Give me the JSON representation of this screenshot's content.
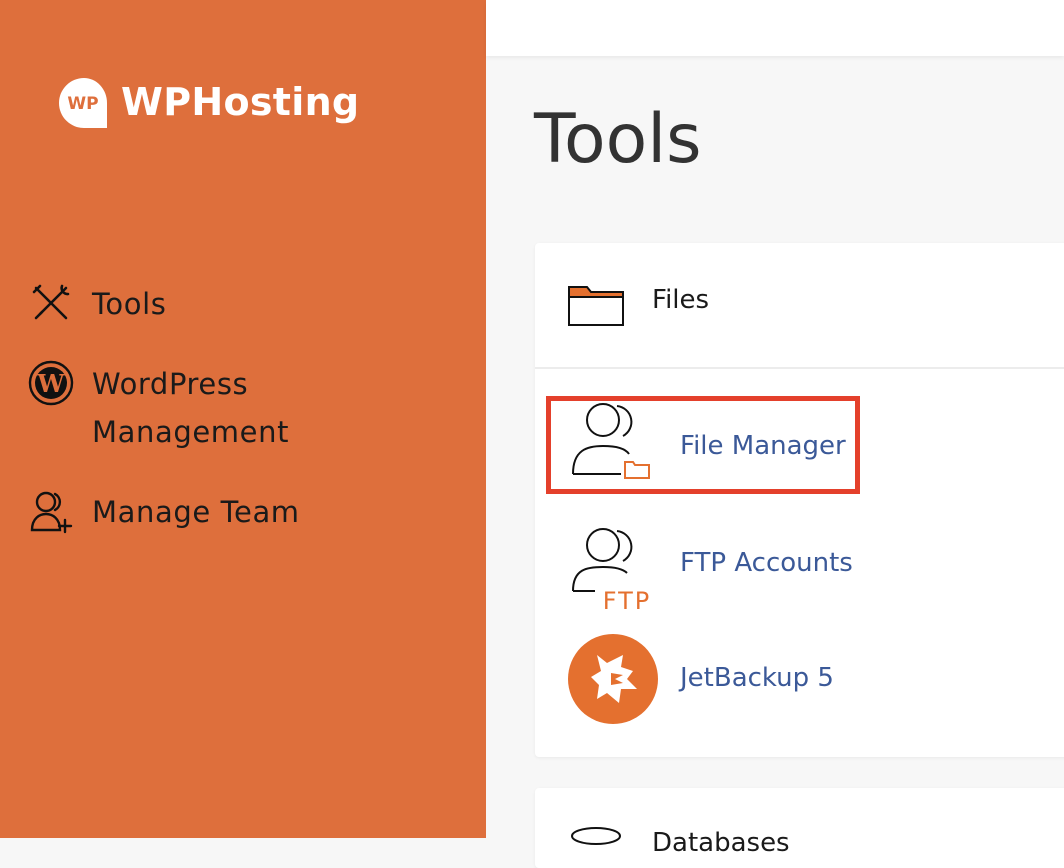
{
  "brand": {
    "name": "WPHosting",
    "logo_mark": "WP",
    "sidebar_color": "#de6f3c",
    "accent": "#e4402b"
  },
  "sidebar": {
    "items": [
      {
        "label": "Tools",
        "icon": "tools-icon"
      },
      {
        "label": "WordPress Management",
        "icon": "wordpress-icon"
      },
      {
        "label": "Manage Team",
        "icon": "add-user-icon"
      }
    ]
  },
  "main": {
    "title": "Tools",
    "files_section": {
      "title": "Files",
      "icon": "folder-icon",
      "tools": [
        {
          "label": "File Manager",
          "icon": "file-manager-icon",
          "highlighted": true
        },
        {
          "label": "FTP Accounts",
          "icon": "ftp-accounts-icon",
          "icon_text": "FTP"
        },
        {
          "label": "JetBackup 5",
          "icon": "jetbackup-icon"
        }
      ]
    },
    "next_section": {
      "title": "Databases",
      "icon": "database-icon"
    }
  }
}
